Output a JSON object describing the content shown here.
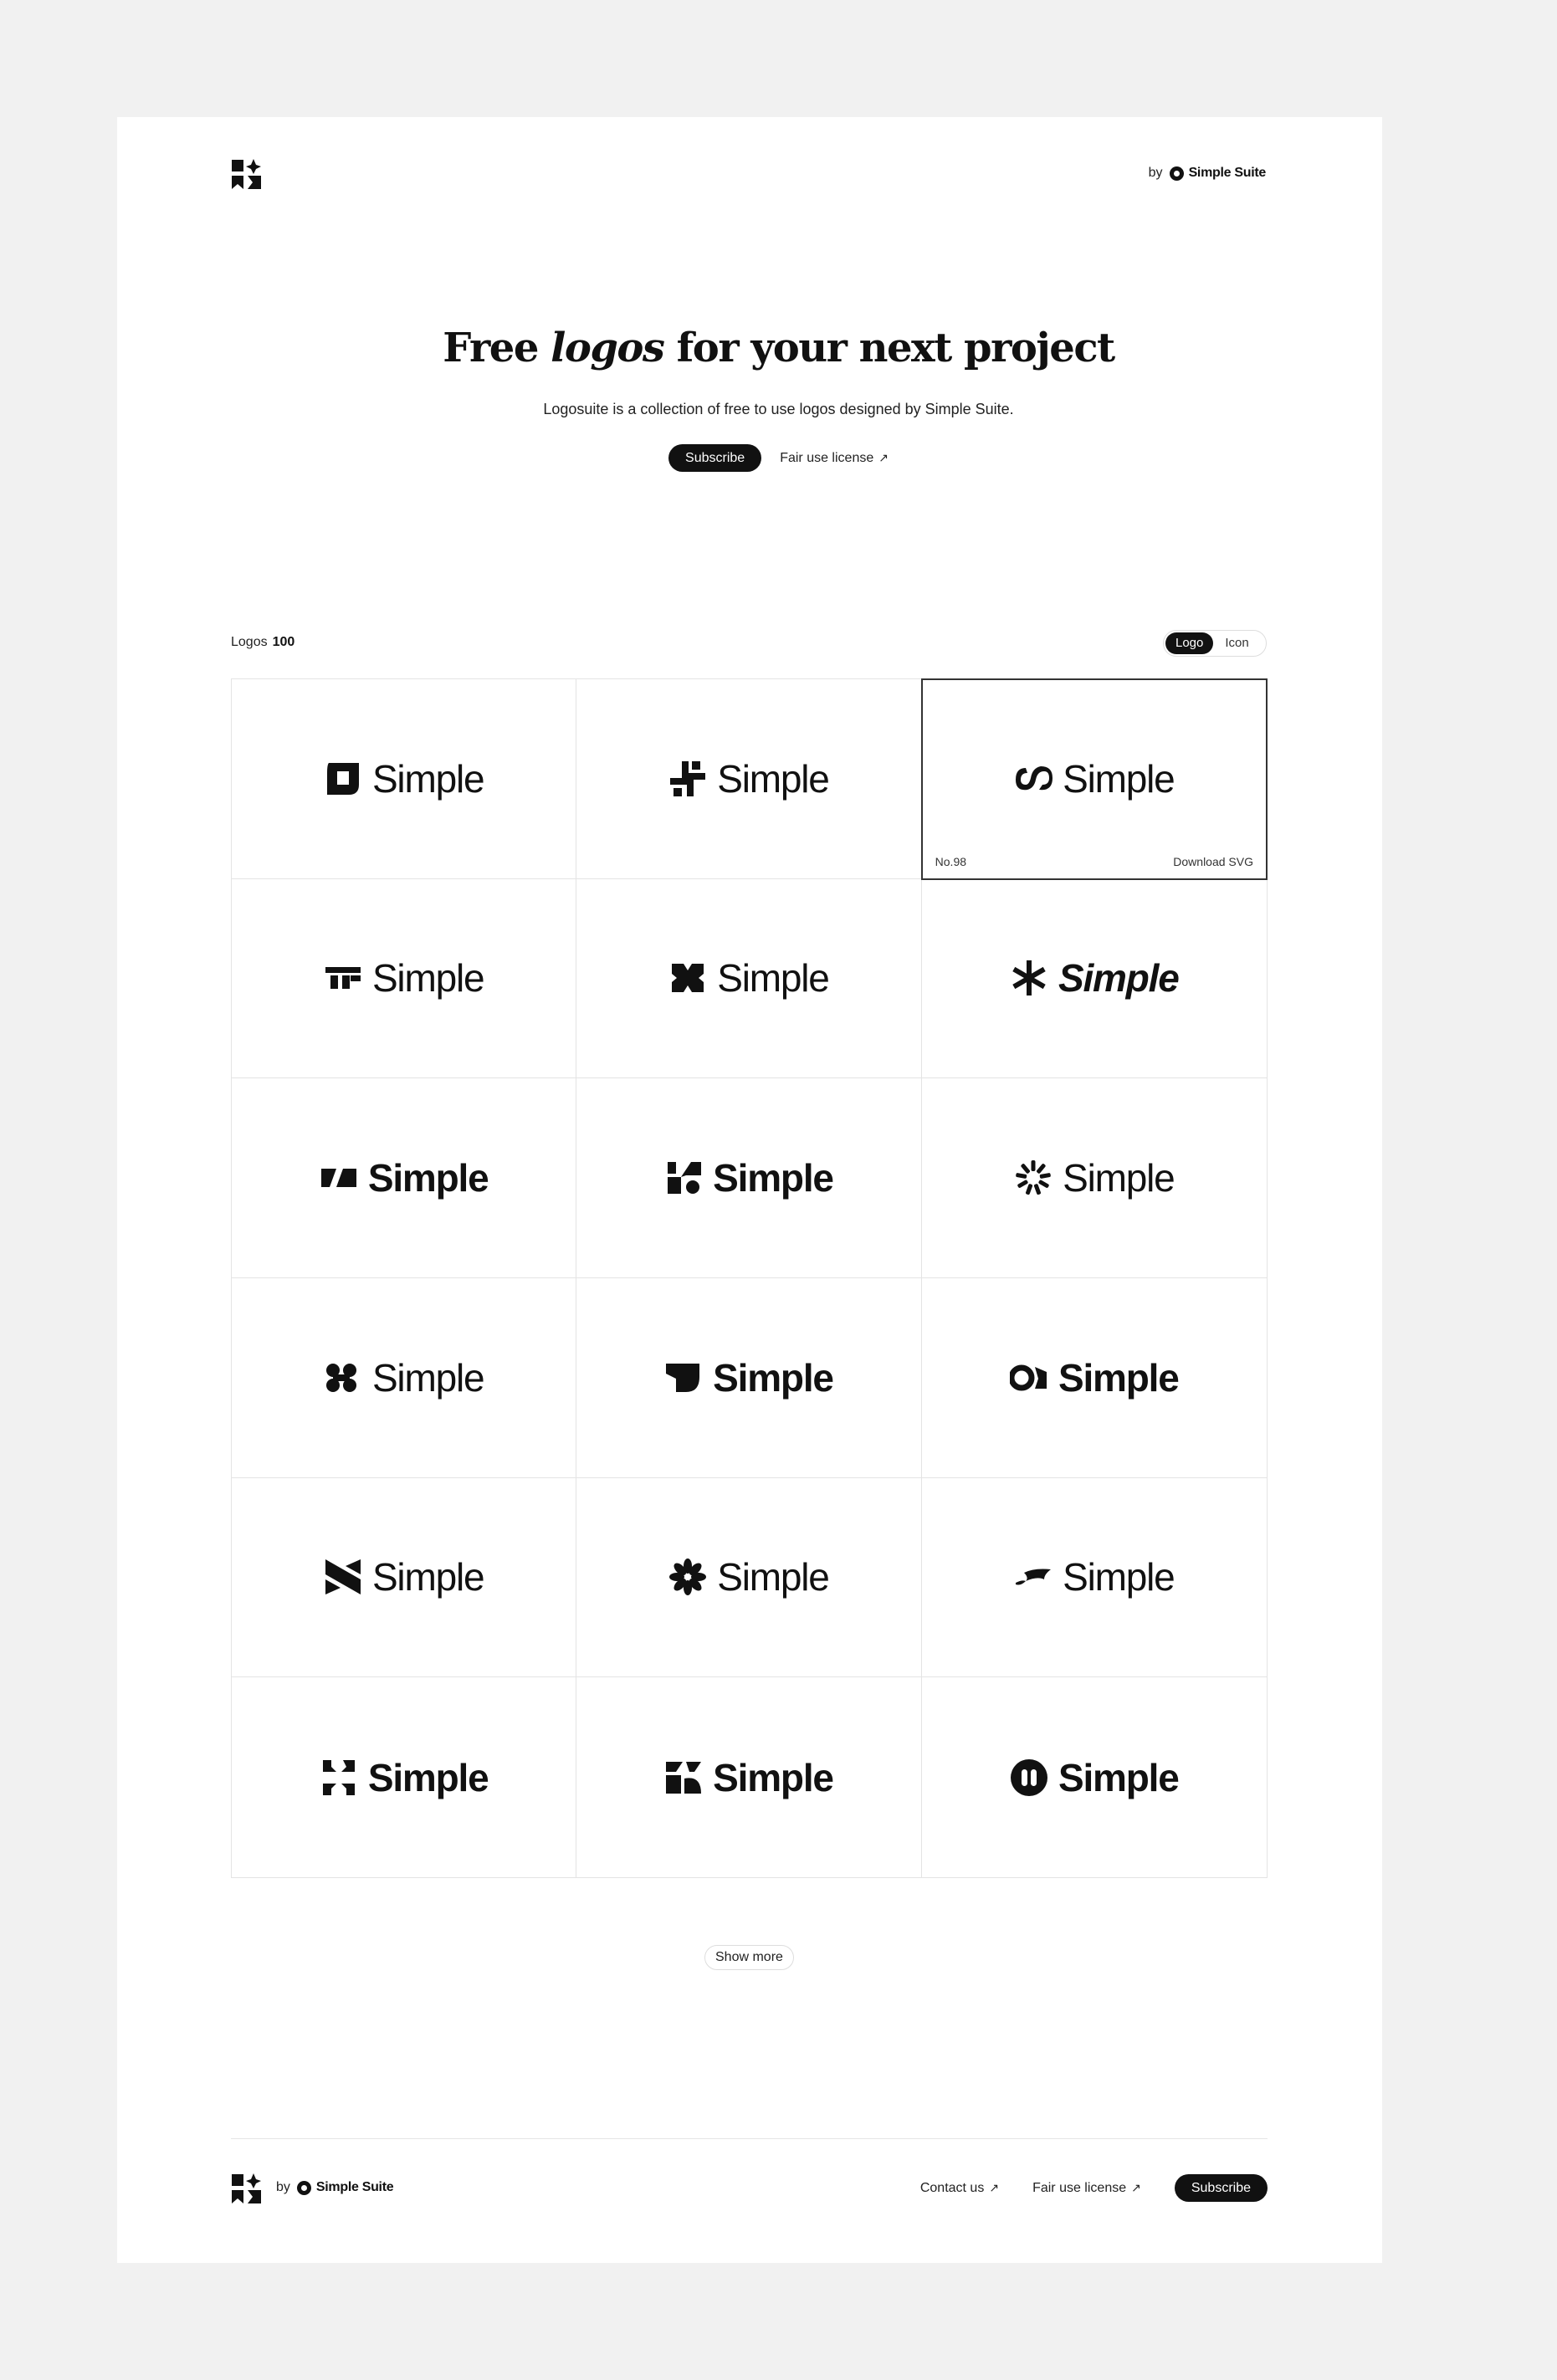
{
  "header": {
    "by_label": "by",
    "suite_name": "Simple Suite"
  },
  "hero": {
    "title_before": "Free ",
    "title_em": "logos",
    "title_after": " for your next project",
    "subtitle": "Logosuite is a collection of free to use logos designed by Simple Suite.",
    "subscribe_label": "Subscribe",
    "license_label": "Fair use license",
    "arrow": "↗"
  },
  "toolbar": {
    "logos_label": "Logos",
    "logos_count": "100",
    "toggle_logo": "Logo",
    "toggle_icon": "Icon"
  },
  "grid": {
    "wordmark": "Simple",
    "hover_number": "No.98",
    "hover_download": "Download SVG"
  },
  "show_more": "Show more",
  "footer": {
    "by_label": "by",
    "suite_name": "Simple Suite",
    "contact_label": "Contact us",
    "license_label": "Fair use license",
    "subscribe_label": "Subscribe",
    "arrow": "↗"
  }
}
